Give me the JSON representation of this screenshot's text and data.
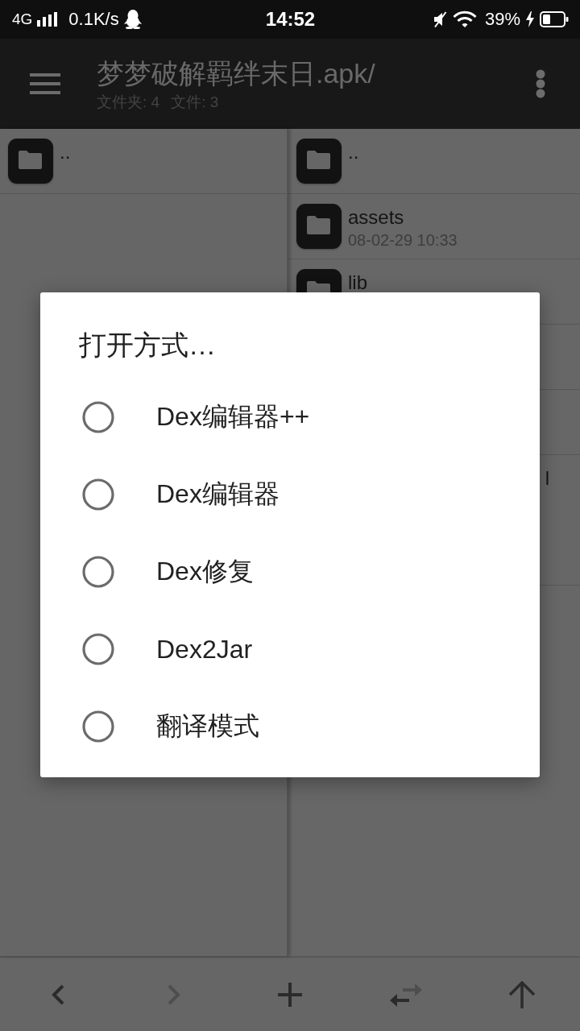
{
  "status_bar": {
    "network": "4G",
    "speed": "0.1K/s",
    "time": "14:52",
    "battery": "39%"
  },
  "toolbar": {
    "title": "梦梦破解羁绊末日.apk/",
    "counts": [
      "文件夹: 4",
      "文件: 3"
    ]
  },
  "left_pane": {
    "items": [
      {
        "kind": "folder",
        "name": ".."
      }
    ]
  },
  "right_pane": {
    "items": [
      {
        "kind": "folder",
        "name": ".."
      },
      {
        "kind": "folder",
        "name": "assets",
        "date": "08-02-29 10:33"
      },
      {
        "kind": "folder_top",
        "name": "lib"
      },
      {
        "kind": "blank"
      },
      {
        "kind": "blank"
      },
      {
        "kind": "partial",
        "name": "l"
      }
    ]
  },
  "dialog": {
    "title": "打开方式…",
    "options": [
      {
        "label": "Dex编辑器++",
        "selected": false
      },
      {
        "label": "Dex编辑器",
        "selected": false
      },
      {
        "label": "Dex修复",
        "selected": false
      },
      {
        "label": "Dex2Jar",
        "selected": false
      },
      {
        "label": "翻译模式",
        "selected": false
      }
    ]
  },
  "bottom_bar": {
    "buttons": [
      {
        "kind": "back",
        "disabled": false
      },
      {
        "kind": "forward",
        "disabled": true
      },
      {
        "kind": "add",
        "disabled": false
      },
      {
        "kind": "swap",
        "disabled": false
      },
      {
        "kind": "up",
        "disabled": false
      }
    ]
  }
}
